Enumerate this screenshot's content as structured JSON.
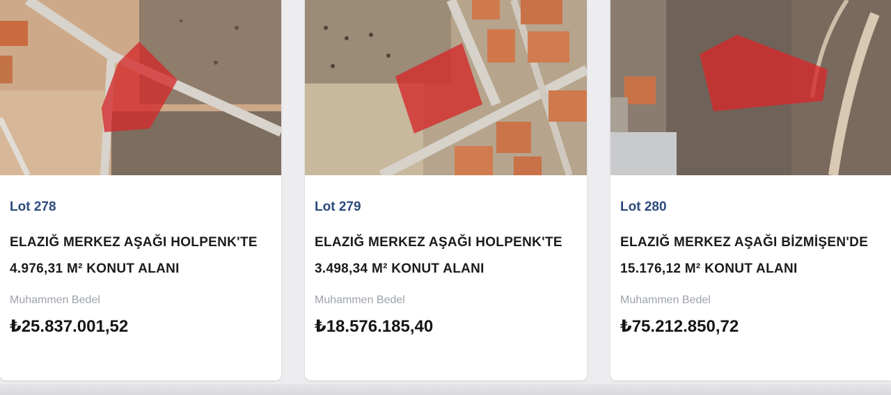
{
  "listings": [
    {
      "lot": "Lot 278",
      "title_line1": "ELAZIĞ MERKEZ AŞAĞI HOLPENK'TE",
      "title_line2": "4.976,31 M² KONUT ALANI",
      "price_label": "Muhammen Bedel",
      "price": "₺25.837.001,52"
    },
    {
      "lot": "Lot 279",
      "title_line1": "ELAZIĞ MERKEZ AŞAĞI HOLPENK'TE",
      "title_line2": "3.498,34 M² KONUT ALANI",
      "price_label": "Muhammen Bedel",
      "price": "₺18.576.185,40"
    },
    {
      "lot": "Lot 280",
      "title_line1": "ELAZIĞ MERKEZ AŞAĞI BİZMİŞEN'DE",
      "title_line2": "15.176,12 M² KONUT ALANI",
      "price_label": "Muhammen Bedel",
      "price": "₺75.212.850,72"
    }
  ],
  "colors": {
    "lot_blue": "#2c4a7c",
    "parcel_red": "#d42a2a",
    "label_gray": "#9ea3aa"
  }
}
